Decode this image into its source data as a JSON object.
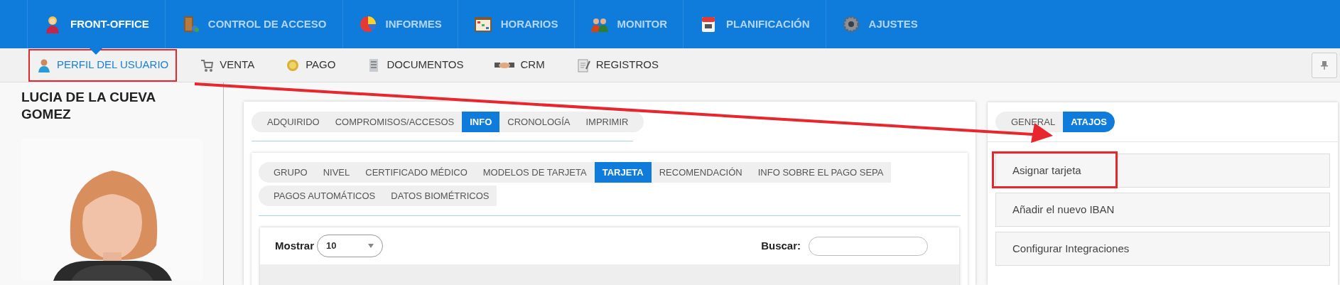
{
  "top_nav": [
    {
      "label": "FRONT-OFFICE",
      "selected": true
    },
    {
      "label": "CONTROL DE ACCESO",
      "selected": false
    },
    {
      "label": "INFORMES",
      "selected": false
    },
    {
      "label": "HORARIOS",
      "selected": false
    },
    {
      "label": "MONITOR",
      "selected": false
    },
    {
      "label": "PLANIFICACIÓN",
      "selected": false
    },
    {
      "label": "AJUSTES",
      "selected": false
    }
  ],
  "sub_nav": [
    {
      "label": "PERFIL DEL USUARIO",
      "selected": true,
      "annotated": true
    },
    {
      "label": "VENTA",
      "selected": false,
      "annotated": false
    },
    {
      "label": "PAGO",
      "selected": false,
      "annotated": false
    },
    {
      "label": "DOCUMENTOS",
      "selected": false,
      "annotated": false
    },
    {
      "label": "CRM",
      "selected": false,
      "annotated": false
    },
    {
      "label": "REGISTROS",
      "selected": false,
      "annotated": false
    }
  ],
  "profile": {
    "name": "LUCIA DE LA CUEVA GOMEZ"
  },
  "main_tabs": [
    {
      "label": "ADQUIRIDO",
      "selected": false
    },
    {
      "label": "COMPROMISOS/ACCESOS",
      "selected": false
    },
    {
      "label": "INFO",
      "selected": true
    },
    {
      "label": "CRONOLOGÍA",
      "selected": false
    },
    {
      "label": "IMPRIMIR",
      "selected": false
    }
  ],
  "info_tabs": [
    [
      {
        "label": "GRUPO",
        "selected": false
      },
      {
        "label": "NIVEL",
        "selected": false
      },
      {
        "label": "CERTIFICADO MÉDICO",
        "selected": false
      },
      {
        "label": "MODELOS DE TARJETA",
        "selected": false
      },
      {
        "label": "TARJETA",
        "selected": true
      },
      {
        "label": "RECOMENDACIÓN",
        "selected": false
      },
      {
        "label": "INFO SOBRE EL PAGO SEPA",
        "selected": false
      }
    ],
    [
      {
        "label": "PAGOS AUTOMÁTICOS",
        "selected": false
      },
      {
        "label": "DATOS BIOMÉTRICOS",
        "selected": false
      }
    ]
  ],
  "table": {
    "show_label": "Mostrar",
    "page_size": "10",
    "search_label": "Buscar:"
  },
  "side_tabs": [
    {
      "label": "GENERAL",
      "selected": false
    },
    {
      "label": "ATAJOS",
      "selected": true
    }
  ],
  "shortcuts": [
    {
      "label": "Asignar tarjeta",
      "annotated": true
    },
    {
      "label": "Añadir el nuevo IBAN",
      "annotated": false
    },
    {
      "label": "Configurar Integraciones",
      "annotated": false
    }
  ]
}
